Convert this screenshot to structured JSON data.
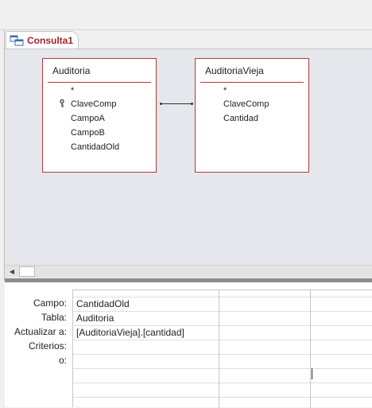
{
  "document_tab": {
    "label": "Consulta1",
    "icon": "query-design-icon"
  },
  "tables": [
    {
      "name": "Auditoria",
      "fields": [
        {
          "label": "*",
          "primary_key": false
        },
        {
          "label": "ClaveComp",
          "primary_key": true
        },
        {
          "label": "CampoA",
          "primary_key": false
        },
        {
          "label": "CampoB",
          "primary_key": false
        },
        {
          "label": "CantidadOld",
          "primary_key": false
        }
      ]
    },
    {
      "name": "AuditoriaVieja",
      "fields": [
        {
          "label": "*",
          "primary_key": false
        },
        {
          "label": "ClaveComp",
          "primary_key": false
        },
        {
          "label": "Cantidad",
          "primary_key": false
        }
      ]
    }
  ],
  "grid": {
    "row_labels": {
      "campo": "Campo:",
      "tabla": "Tabla:",
      "actualizar": "Actualizar a:",
      "criterios": "Criterios:",
      "o": "o:"
    },
    "column1": {
      "campo": "CantidadOld",
      "tabla": "Auditoria",
      "actualizar": "[AuditoriaVieja].[cantidad]"
    }
  },
  "colors": {
    "tab_text": "#a4262c",
    "table_border": "#b03a3a",
    "design_background": "#e6e7ec",
    "splitter": "#8d8d8d"
  }
}
